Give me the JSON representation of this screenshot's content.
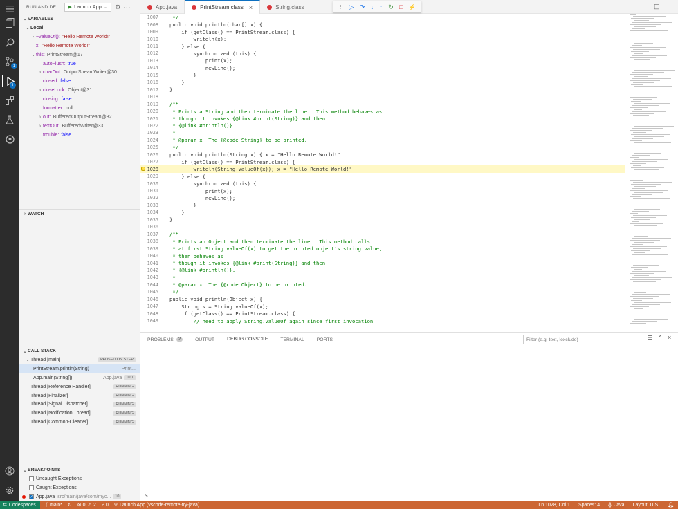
{
  "sidebar": {
    "header": "RUN AND DE...",
    "run_config": "Launch App",
    "variables_title": "VARIABLES",
    "local_label": "Local",
    "variables": [
      {
        "name": "~valueOf():",
        "value": "\"Hello Remote World!\"",
        "kind": "str",
        "chev": ">",
        "indent": 1
      },
      {
        "name": "x:",
        "value": "\"Hello Remote World!\"",
        "kind": "str",
        "chev": "",
        "indent": 1
      },
      {
        "name": "this:",
        "value": "PrintStream@17",
        "kind": "obj",
        "chev": "v",
        "indent": 1
      },
      {
        "name": "autoFlush:",
        "value": "true",
        "kind": "kw",
        "chev": "",
        "indent": 2
      },
      {
        "name": "charOut:",
        "value": "OutputStreamWriter@30",
        "kind": "obj",
        "chev": ">",
        "indent": 2
      },
      {
        "name": "closed:",
        "value": "false",
        "kind": "kw",
        "chev": "",
        "indent": 2
      },
      {
        "name": "closeLock:",
        "value": "Object@31",
        "kind": "obj",
        "chev": ">",
        "indent": 2
      },
      {
        "name": "closing:",
        "value": "false",
        "kind": "kw",
        "chev": "",
        "indent": 2
      },
      {
        "name": "formatter:",
        "value": "null",
        "kind": "obj",
        "chev": "",
        "indent": 2
      },
      {
        "name": "out:",
        "value": "BufferedOutputStream@32",
        "kind": "obj",
        "chev": ">",
        "indent": 2
      },
      {
        "name": "textOut:",
        "value": "BufferedWriter@33",
        "kind": "obj",
        "chev": ">",
        "indent": 2
      },
      {
        "name": "trouble:",
        "value": "false",
        "kind": "kw",
        "chev": "",
        "indent": 2
      }
    ],
    "watch_title": "WATCH",
    "callstack_title": "CALL STACK",
    "threads": [
      {
        "name": "Thread [main]",
        "status": "PAUSED ON STEP",
        "chev": "v"
      },
      {
        "name": "PrintStream.println(String)",
        "file": "Print...",
        "frame": true,
        "selected": true
      },
      {
        "name": "App.main(String[])",
        "file": "App.java",
        "pos": "10:1",
        "frame": true
      },
      {
        "name": "Thread [Reference Handler]",
        "status": "RUNNING"
      },
      {
        "name": "Thread [Finalizer]",
        "status": "RUNNING"
      },
      {
        "name": "Thread [Signal Dispatcher]",
        "status": "RUNNING"
      },
      {
        "name": "Thread [Notification Thread]",
        "status": "RUNNING"
      },
      {
        "name": "Thread [Common-Cleaner]",
        "status": "RUNNING"
      }
    ],
    "breakpoints_title": "BREAKPOINTS",
    "breakpoints": [
      {
        "label": "Uncaught Exceptions",
        "checked": false
      },
      {
        "label": "Caught Exceptions",
        "checked": false
      },
      {
        "label": "App.java",
        "path": "src/main/java/com/myc...",
        "count": "10",
        "checked": true,
        "dot": true
      }
    ]
  },
  "tabs": [
    {
      "label": "App.java",
      "active": false
    },
    {
      "label": "PrintStream.class",
      "active": true,
      "close": "×"
    },
    {
      "label": "String.class",
      "active": false
    }
  ],
  "editor": {
    "lines": [
      {
        "n": "1007",
        "text": " */"
      },
      {
        "n": "1008",
        "text": "public void println(char[] x) {"
      },
      {
        "n": "1009",
        "text": "    if (getClass() == PrintStream.class) {"
      },
      {
        "n": "1010",
        "text": "        writeln(x);"
      },
      {
        "n": "1011",
        "text": "    } else {"
      },
      {
        "n": "1012",
        "text": "        synchronized (this) {"
      },
      {
        "n": "1013",
        "text": "            print(x);"
      },
      {
        "n": "1014",
        "text": "            newLine();"
      },
      {
        "n": "1015",
        "text": "        }"
      },
      {
        "n": "1016",
        "text": "    }"
      },
      {
        "n": "1017",
        "text": "}"
      },
      {
        "n": "1018",
        "text": ""
      },
      {
        "n": "1019",
        "text": "/**"
      },
      {
        "n": "1020",
        "text": " * Prints a String and then terminate the line.  This method behaves as"
      },
      {
        "n": "1021",
        "text": " * though it invokes {@link #print(String)} and then"
      },
      {
        "n": "1022",
        "text": " * {@link #println()}."
      },
      {
        "n": "1023",
        "text": " *"
      },
      {
        "n": "1024",
        "text": " * @param x  The {@code String} to be printed."
      },
      {
        "n": "1025",
        "text": " */"
      },
      {
        "n": "1026",
        "text": "public void println(String x) { x = \"Hello Remote World!\""
      },
      {
        "n": "1027",
        "text": "    if (getClass() == PrintStream.class) {"
      },
      {
        "n": "1028",
        "text": "        writeln(String.valueOf(x)); x = \"Hello Remote World!\"",
        "hl": true
      },
      {
        "n": "1029",
        "text": "    } else {"
      },
      {
        "n": "1030",
        "text": "        synchronized (this) {"
      },
      {
        "n": "1031",
        "text": "            print(x);"
      },
      {
        "n": "1032",
        "text": "            newLine();"
      },
      {
        "n": "1033",
        "text": "        }"
      },
      {
        "n": "1034",
        "text": "    }"
      },
      {
        "n": "1035",
        "text": "}"
      },
      {
        "n": "1036",
        "text": ""
      },
      {
        "n": "1037",
        "text": "/**"
      },
      {
        "n": "1038",
        "text": " * Prints an Object and then terminate the line.  This method calls"
      },
      {
        "n": "1039",
        "text": " * at first String.valueOf(x) to get the printed object's string value,"
      },
      {
        "n": "1040",
        "text": " * then behaves as"
      },
      {
        "n": "1041",
        "text": " * though it invokes {@link #print(String)} and then"
      },
      {
        "n": "1042",
        "text": " * {@link #println()}."
      },
      {
        "n": "1043",
        "text": " *"
      },
      {
        "n": "1044",
        "text": " * @param x  The {@code Object} to be printed."
      },
      {
        "n": "1045",
        "text": " */"
      },
      {
        "n": "1046",
        "text": "public void println(Object x) {"
      },
      {
        "n": "1047",
        "text": "    String s = String.valueOf(x);"
      },
      {
        "n": "1048",
        "text": "    if (getClass() == PrintStream.class) {"
      },
      {
        "n": "1049",
        "text": "        // need to apply String.valueOf again since first invocation"
      }
    ]
  },
  "panel": {
    "tabs": [
      {
        "label": "PROBLEMS",
        "count": "2"
      },
      {
        "label": "OUTPUT"
      },
      {
        "label": "DEBUG CONSOLE",
        "active": true
      },
      {
        "label": "TERMINAL"
      },
      {
        "label": "PORTS"
      }
    ],
    "filter_placeholder": "Filter (e.g. text, !exclude)",
    "prompt": ">"
  },
  "status": {
    "remote": "Codespaces",
    "branch": "main*",
    "errors": "0",
    "warnings": "2",
    "ports": "0",
    "launch": "Launch App (vscode-remote-try-java)",
    "position": "Ln 1028, Col 1",
    "spaces": "Spaces: 4",
    "language": "Java",
    "layout": "Layout: U.S."
  },
  "colors": {
    "status_bar": "#cc6633",
    "activity_bar": "#2c2c2c",
    "current_line": "#fff8c5",
    "accent": "#0e70c0"
  }
}
